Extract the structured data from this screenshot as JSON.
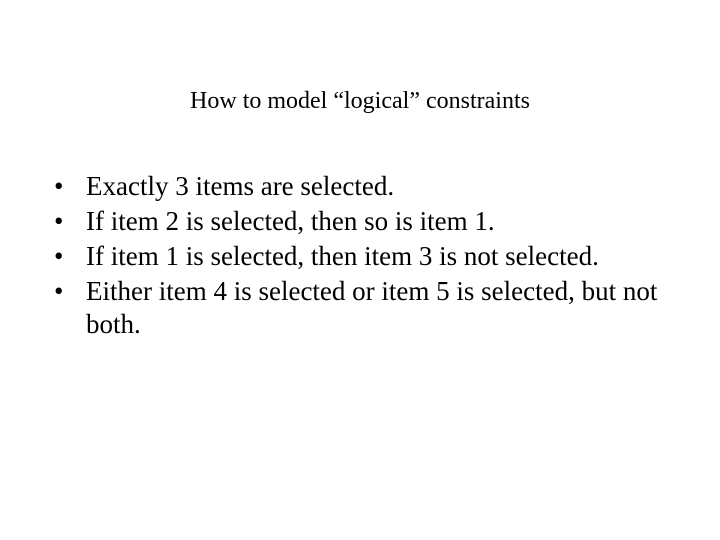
{
  "title": "How to model “logical” constraints",
  "bullets": [
    "Exactly 3 items are selected.",
    "If item 2 is selected, then so is item 1.",
    "If item 1 is selected, then item 3 is not selected.",
    "Either item 4 is selected or item 5 is selected, but not both."
  ],
  "bullet_glyph": "•"
}
